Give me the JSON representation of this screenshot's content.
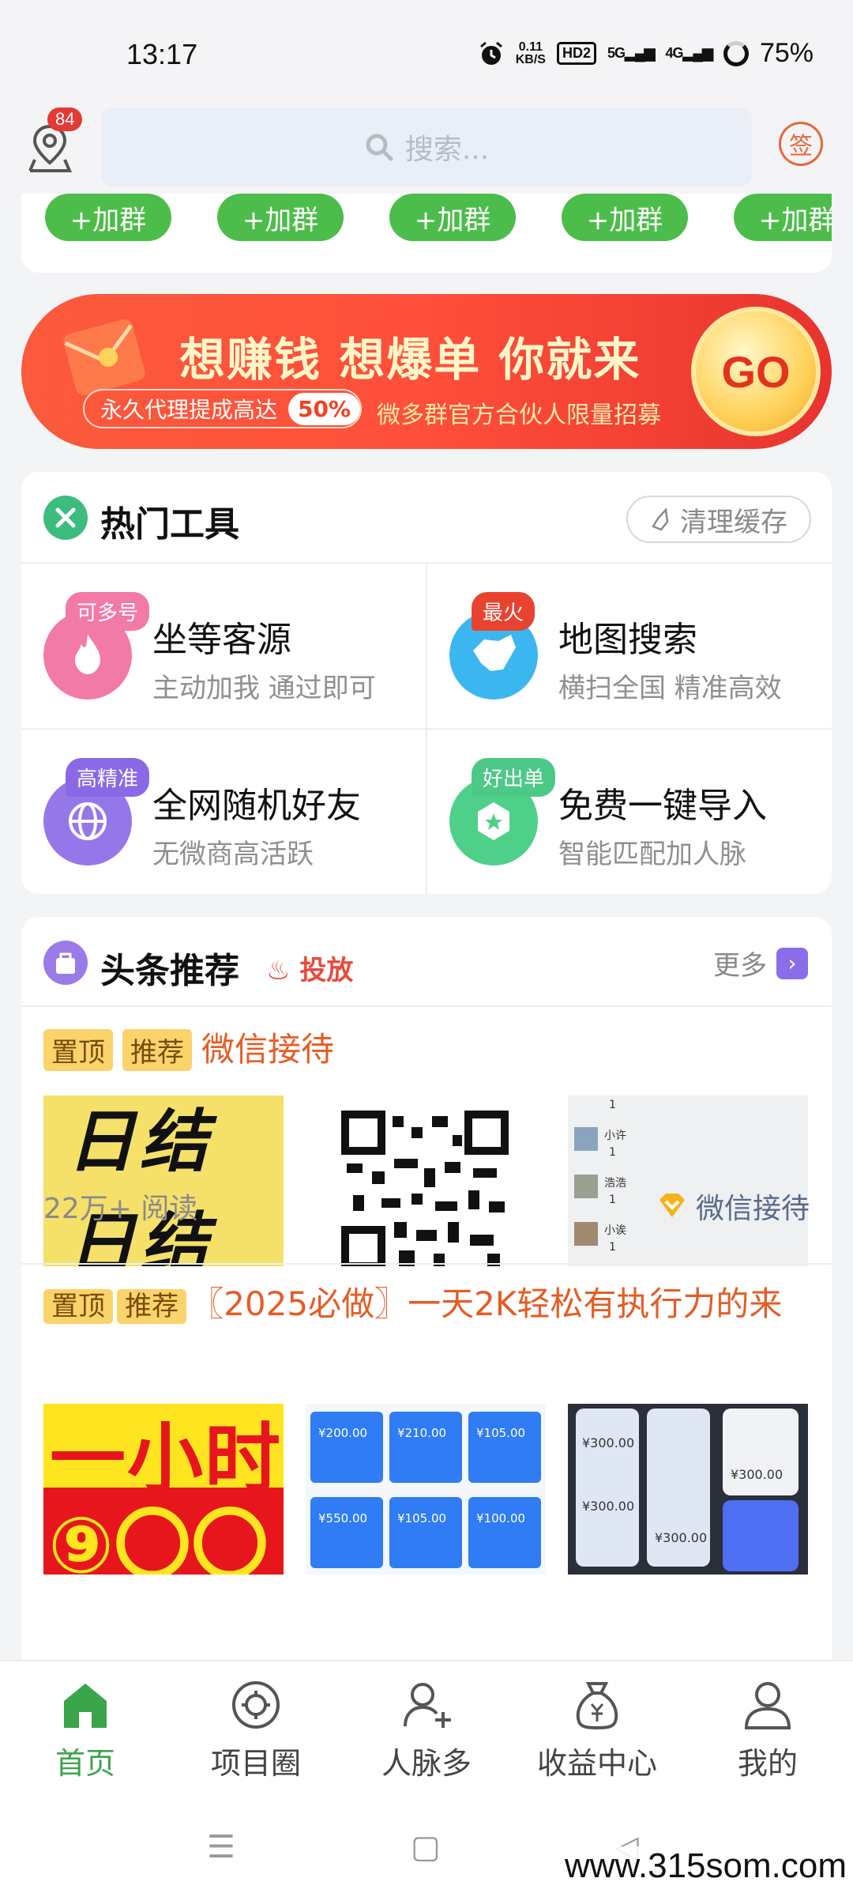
{
  "status_bar": {
    "time": "13:17",
    "net_speed_value": "0.11",
    "net_speed_unit": "KB/S",
    "hd": "HD2",
    "sim1": "5G",
    "sim2": "4G",
    "battery": "75%"
  },
  "header": {
    "notification_count": "84",
    "search_placeholder": "搜索...",
    "signin_label": "签"
  },
  "groups": {
    "buttons": [
      "+加群",
      "+加群",
      "+加群",
      "+加群",
      "+加群"
    ]
  },
  "banner": {
    "headline": "想赚钱 想爆单 你就来",
    "pill_text": "永久代理提成高达",
    "pill_percent": "50%",
    "subtext": "微多群官方合伙人限量招募",
    "go_label": "GO"
  },
  "tools": {
    "title": "热门工具",
    "clear_cache": "清理缓存",
    "items": [
      {
        "tag": "可多号",
        "name": "坐等客源",
        "desc": "主动加我 通过即可",
        "color": "#f27aa6",
        "tag_color": "#f27aa6"
      },
      {
        "tag": "最火",
        "name": "地图搜索",
        "desc": "横扫全国 精准高效",
        "color": "#3cb6ef",
        "tag_color": "#e8432f"
      },
      {
        "tag": "高精准",
        "name": "全网随机好友",
        "desc": "无微商高活跃",
        "color": "#9677ea",
        "tag_color": "#8a68e6"
      },
      {
        "tag": "好出单",
        "name": "免费一键导入",
        "desc": "智能匹配加人脉",
        "color": "#4fd08a",
        "tag_color": "#4cc987"
      }
    ]
  },
  "headlines": {
    "title": "头条推荐",
    "promote": "投放",
    "more": "更多",
    "items": [
      {
        "chips": [
          "置顶",
          "推荐"
        ],
        "title": "微信接待",
        "reads": "22万+ 阅读",
        "source": "微信接待",
        "thumb1_text": [
          "日结",
          "日结"
        ],
        "thumb3_names": [
          "小许",
          "浩浩",
          "小诶"
        ],
        "thumb3_count": "1"
      },
      {
        "chips": [
          "置顶",
          "推荐"
        ],
        "title": "〖2025必做〗一天2K轻松有执行力的来",
        "thumb1_text": [
          "一小时",
          "⑨〇〇"
        ],
        "thumb2_amounts": [
          "¥200.00",
          "¥210.00",
          "¥105.00",
          "¥550.00",
          "¥105.00",
          "¥100.00"
        ],
        "thumb3_amounts": [
          "¥300.00",
          "¥300.00",
          "¥300.00",
          "¥300.00"
        ]
      }
    ]
  },
  "bottom_nav": {
    "items": [
      {
        "label": "首页",
        "active": true
      },
      {
        "label": "项目圈",
        "active": false
      },
      {
        "label": "人脉多",
        "active": false
      },
      {
        "label": "收益中心",
        "active": false
      },
      {
        "label": "我的",
        "active": false
      }
    ]
  },
  "watermark": "www.315som.com",
  "colors": {
    "brand_green": "#4cbd4a",
    "accent_orange": "#e65c25",
    "banner_red": "#ff4f3a"
  }
}
